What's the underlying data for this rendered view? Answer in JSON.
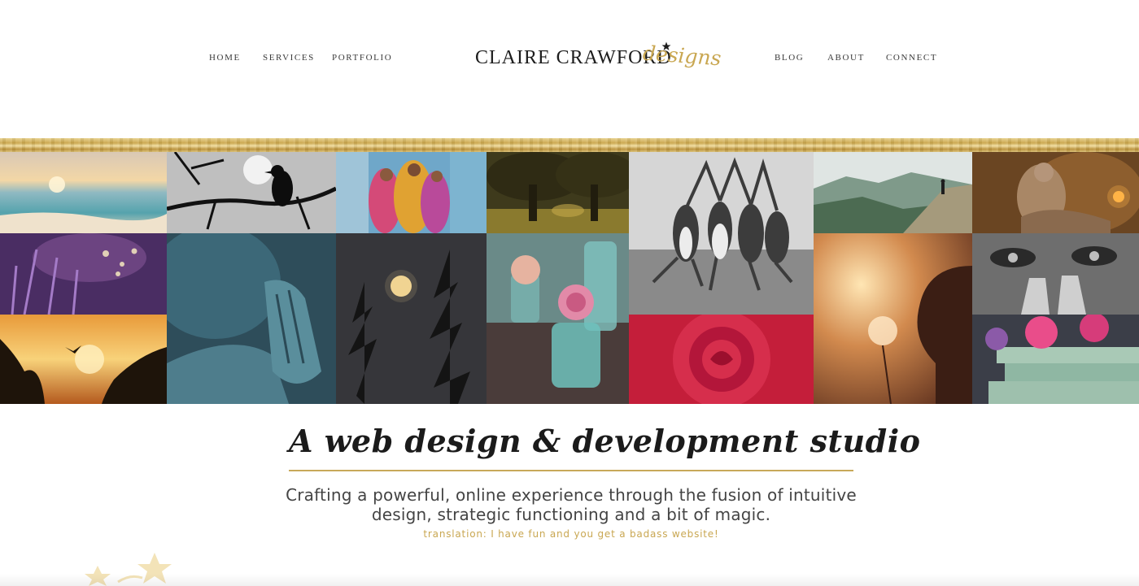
{
  "nav": {
    "left": [
      {
        "label": "HOME"
      },
      {
        "label": "SERVICES"
      },
      {
        "label": "PORTFOLIO"
      }
    ],
    "right": [
      {
        "label": "BLOG"
      },
      {
        "label": "ABOUT"
      },
      {
        "label": "CONNECT"
      }
    ]
  },
  "logo": {
    "name": "CLAIRE CRAWFORD",
    "script": "designs",
    "star_color": "#1d1d1d"
  },
  "colors": {
    "gold": "#c9a752",
    "text": "#444444",
    "headline": "#1b1b1b"
  },
  "hero": {
    "images": [
      "beach-sunset-photo",
      "crow-on-branch-photo",
      "women-in-saris-photo",
      "oak-trees-photo",
      "dancing-women-photo",
      "mountain-hiker-photo",
      "statue-lantern-photo",
      "lavender-field-photo",
      "praying-hands-statue-photo",
      "full-moon-trees-photo",
      "roses-in-bottles-photo",
      "woman-dandelion-photo",
      "elderly-face-photo",
      "bird-sunset-photo",
      "red-rose-photo",
      "flowers-on-books-photo"
    ]
  },
  "tagline": {
    "headline": "A web design & development studio",
    "subline": "Crafting a powerful, online experience through the fusion of intuitive design, strategic functioning and a bit of magic.",
    "translation": "translation: I have fun and you get a badass website!"
  }
}
